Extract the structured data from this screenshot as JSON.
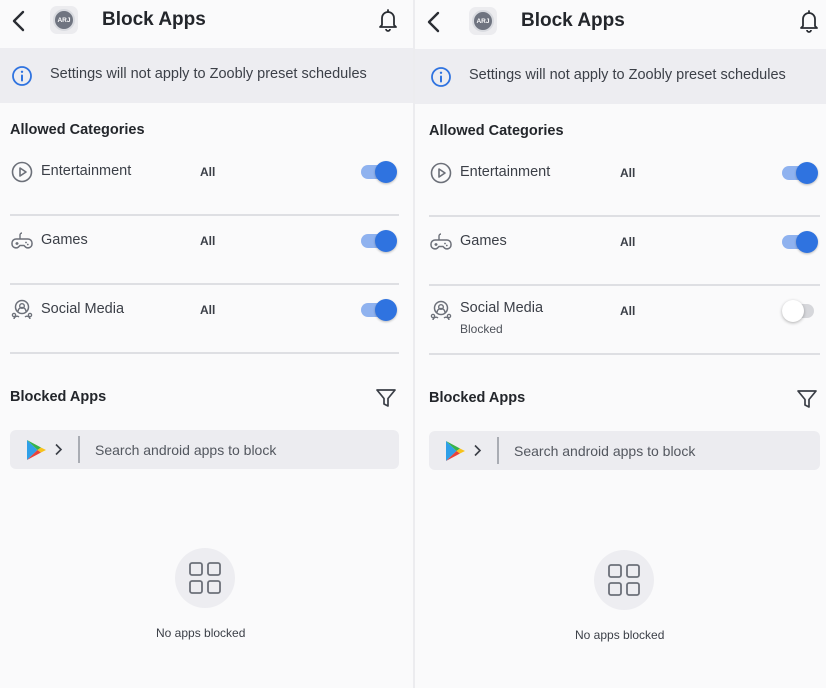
{
  "colors": {
    "accent": "#2f73e0",
    "toggle_track_on": "#8fb2ef",
    "toggle_track_off": "#d6d7db",
    "banner_bg": "#ededf1",
    "info_icon": "#2f73e0"
  },
  "screens": [
    {
      "header": {
        "title": "Block Apps",
        "avatar_text": "ARJ"
      },
      "banner": {
        "text": "Settings will not apply to Zoobly preset schedules"
      },
      "allowed": {
        "title": "Allowed Categories",
        "items": [
          {
            "label": "Entertainment",
            "scope": "All",
            "enabled": true,
            "icon": "play-circle-icon"
          },
          {
            "label": "Games",
            "scope": "All",
            "enabled": true,
            "icon": "gamepad-icon"
          },
          {
            "label": "Social Media",
            "scope": "All",
            "enabled": true,
            "icon": "people-icon"
          }
        ]
      },
      "blocked": {
        "title": "Blocked Apps",
        "search_placeholder": "Search android apps to block",
        "empty_text": "No apps blocked"
      }
    },
    {
      "header": {
        "title": "Block Apps",
        "avatar_text": "ARJ"
      },
      "banner": {
        "text": "Settings will not apply to Zoobly preset schedules"
      },
      "allowed": {
        "title": "Allowed Categories",
        "items": [
          {
            "label": "Entertainment",
            "scope": "All",
            "enabled": true,
            "icon": "play-circle-icon"
          },
          {
            "label": "Games",
            "scope": "All",
            "enabled": true,
            "icon": "gamepad-icon"
          },
          {
            "label": "Social Media",
            "scope": "All",
            "enabled": false,
            "status": "Blocked",
            "icon": "people-icon"
          }
        ]
      },
      "blocked": {
        "title": "Blocked Apps",
        "search_placeholder": "Search android apps to block",
        "empty_text": "No apps blocked"
      }
    }
  ]
}
